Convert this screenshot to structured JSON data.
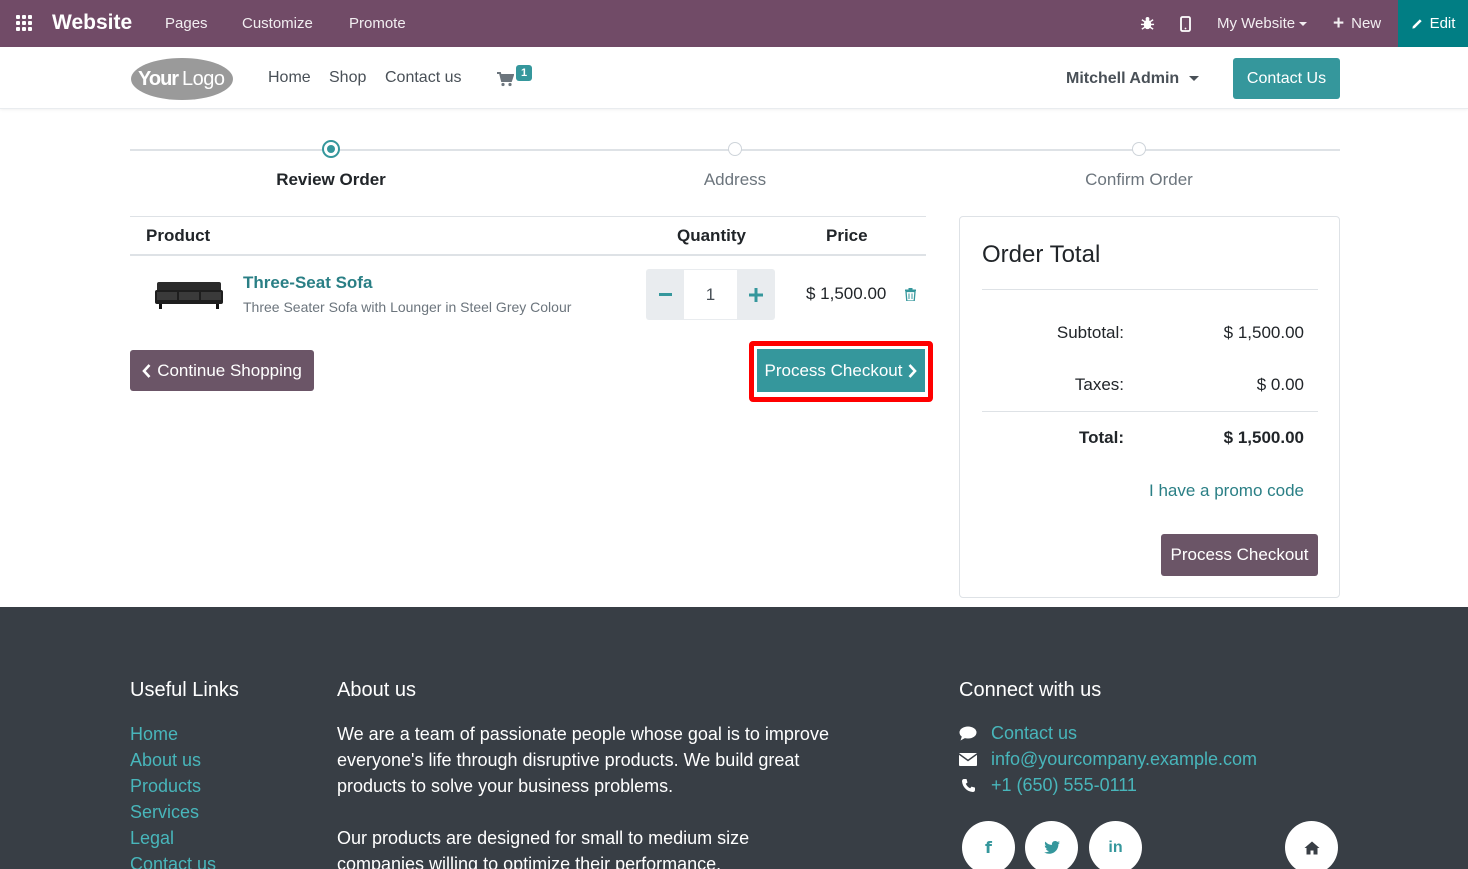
{
  "topbar": {
    "brand": "Website",
    "menu": [
      "Pages",
      "Customize",
      "Promote"
    ],
    "website_selector": "My Website",
    "new_label": "New",
    "edit_label": "Edit",
    "color": "#714b67"
  },
  "header": {
    "nav": [
      "Home",
      "Shop",
      "Contact us"
    ],
    "cart_count": "1",
    "user": "Mitchell Admin",
    "contact_button": "Contact Us",
    "logo_text": "YourLogo"
  },
  "wizard": {
    "steps": [
      "Review Order",
      "Address",
      "Confirm Order"
    ],
    "active_step": 0
  },
  "cart": {
    "columns": [
      "Product",
      "Quantity",
      "Price"
    ],
    "items": [
      {
        "name": "Three-Seat Sofa",
        "description": "Three Seater Sofa with Lounger in Steel Grey Colour",
        "quantity": "1",
        "price": "$ 1,500.00"
      }
    ],
    "continue_label": "Continue Shopping",
    "checkout_label": "Process Checkout"
  },
  "order_total": {
    "title": "Order Total",
    "subtotal_label": "Subtotal:",
    "subtotal": "$ 1,500.00",
    "taxes_label": "Taxes:",
    "taxes": "$ 0.00",
    "total_label": "Total:",
    "total": "$ 1,500.00",
    "promo_label": "I have a promo code",
    "checkout_label": "Process Checkout"
  },
  "footer": {
    "useful_links_title": "Useful Links",
    "useful_links": [
      "Home",
      "About us",
      "Products",
      "Services",
      "Legal",
      "Contact us"
    ],
    "about_title": "About us",
    "about_p1": "We are a team of passionate people whose goal is to improve everyone's life through disruptive products. We build great products to solve your business problems.",
    "about_p2": "Our products are designed for small to medium size companies willing to optimize their performance.",
    "connect_title": "Connect with us",
    "contact_link": "Contact us",
    "email": "info@yourcompany.example.com",
    "phone": "+1 (650) 555-0111",
    "social": [
      "facebook-icon",
      "twitter-icon",
      "linkedin-icon",
      "home-icon"
    ]
  },
  "colors": {
    "accent": "#35979c",
    "secondary": "#6b5567",
    "highlight": "#ff0000",
    "footer_bg": "#383e45"
  }
}
